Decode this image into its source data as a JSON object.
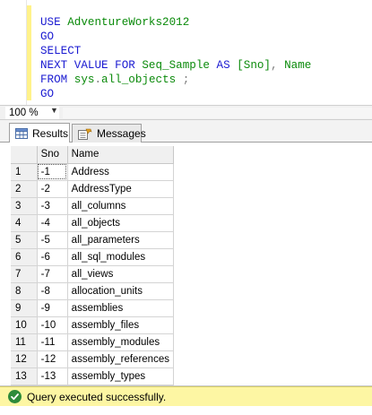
{
  "editor": {
    "lines": [
      [
        {
          "t": "USE ",
          "c": "kw"
        },
        {
          "t": "AdventureWorks2012",
          "c": "id"
        }
      ],
      [
        {
          "t": "GO",
          "c": "kw"
        }
      ],
      [
        {
          "t": "SELECT",
          "c": "kw"
        }
      ],
      [
        {
          "t": "NEXT VALUE FOR ",
          "c": "kw"
        },
        {
          "t": "Seq_Sample ",
          "c": "id"
        },
        {
          "t": "AS ",
          "c": "kw"
        },
        {
          "t": "[Sno]",
          "c": "id"
        },
        {
          "t": ",",
          "c": "sym"
        },
        {
          "t": " Name",
          "c": "id"
        }
      ],
      [
        {
          "t": "FROM ",
          "c": "kw"
        },
        {
          "t": "sys",
          "c": "id"
        },
        {
          "t": ".",
          "c": "sym"
        },
        {
          "t": "all_objects",
          "c": "id"
        },
        {
          "t": " ;",
          "c": "sym"
        }
      ],
      [
        {
          "t": "GO",
          "c": "kw"
        }
      ]
    ]
  },
  "zoom": {
    "value": "100 %"
  },
  "tabs": {
    "results_label": "Results",
    "messages_label": "Messages"
  },
  "grid": {
    "columns": [
      "Sno",
      "Name"
    ],
    "rows": [
      {
        "n": "1",
        "sno": "-1",
        "name": "Address"
      },
      {
        "n": "2",
        "sno": "-2",
        "name": "AddressType"
      },
      {
        "n": "3",
        "sno": "-3",
        "name": "all_columns"
      },
      {
        "n": "4",
        "sno": "-4",
        "name": "all_objects"
      },
      {
        "n": "5",
        "sno": "-5",
        "name": "all_parameters"
      },
      {
        "n": "6",
        "sno": "-6",
        "name": "all_sql_modules"
      },
      {
        "n": "7",
        "sno": "-7",
        "name": "all_views"
      },
      {
        "n": "8",
        "sno": "-8",
        "name": "allocation_units"
      },
      {
        "n": "9",
        "sno": "-9",
        "name": "assemblies"
      },
      {
        "n": "10",
        "sno": "-10",
        "name": "assembly_files"
      },
      {
        "n": "11",
        "sno": "-11",
        "name": "assembly_modules"
      },
      {
        "n": "12",
        "sno": "-12",
        "name": "assembly_references"
      },
      {
        "n": "13",
        "sno": "-13",
        "name": "assembly_types"
      }
    ]
  },
  "status": {
    "message": "Query executed successfully."
  },
  "colors": {
    "status_bg": "#fdf6a3",
    "keyword": "#1a1ad1",
    "identifier": "#0a8a0a",
    "change_bar": "#fff28a"
  }
}
